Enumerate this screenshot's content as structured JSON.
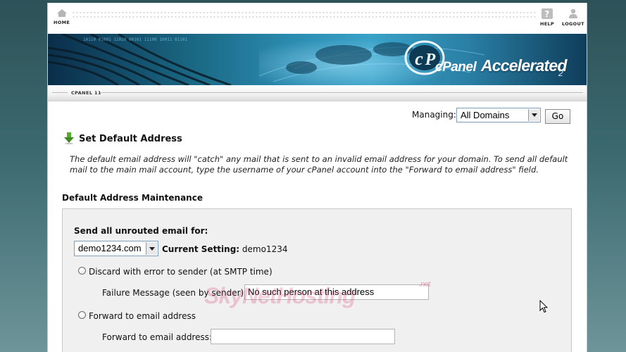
{
  "nav": {
    "home_label": "HOME",
    "help_label": "HELP",
    "logout_label": "LOGOUT"
  },
  "banner": {
    "logo_cp": "cPanel",
    "logo_accelerated": "Accelerated",
    "logo_version": "2"
  },
  "breadcrumb": {
    "label": "CPANEL 11"
  },
  "managing": {
    "label": "Managing:",
    "selected": "All Domains",
    "go_label": "Go"
  },
  "page": {
    "title": "Set Default Address",
    "description": "The default email address will \"catch\" any mail that is sent to an invalid email address for your domain. To send all default mail to the main mail account, type the username of your cPanel account into the \"Forward to email address\" field.",
    "section_title": "Default Address Maintenance"
  },
  "form": {
    "send_all_label": "Send all unrouted email for:",
    "domain_selected": "demo1234.com",
    "current_setting_label": "Current Setting:",
    "current_setting_value": "demo1234",
    "discard_label": "Discard with error to sender (at SMTP time)",
    "failure_message_label": "Failure Message (seen by sender):",
    "failure_message_value": "No such person at this address",
    "forward_radio_label": "Forward to email address",
    "forward_field_label": "Forward to email address:",
    "forward_field_value": ""
  },
  "watermark": {
    "text": "SkyNetHosting",
    "suffix": ".net"
  },
  "colors": {
    "accent": "#2a86ad",
    "green_arrow": "#4a9a2a",
    "panel_bg": "#f0f0f0"
  },
  "icons": [
    "home-icon",
    "help-icon",
    "logout-icon",
    "download-arrow-icon",
    "cursor-icon"
  ]
}
